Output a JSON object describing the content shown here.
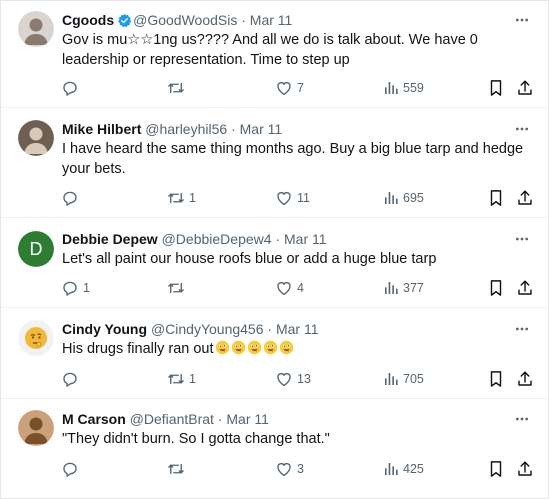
{
  "tweets": [
    {
      "name": "Cgoods",
      "handle": "@GoodWoodSis",
      "separator": "·",
      "date": "Mar 11",
      "verified": true,
      "avatar": {
        "kind": "photo",
        "bg": "#d9d4cf",
        "fg": "#8a7b6e"
      },
      "text": "Gov is mu☆☆1ng us???? And all we do is talk about. We have 0 leadership or representation. Time to step up",
      "replies": "",
      "reposts": "",
      "likes": "7",
      "views": "559"
    },
    {
      "name": "Mike Hilbert",
      "handle": "@harleyhil56",
      "separator": "·",
      "date": "Mar 11",
      "verified": false,
      "avatar": {
        "kind": "photo",
        "bg": "#6d5f52",
        "fg": "#d8c9b8"
      },
      "text": "I have heard the same thing months ago. Buy a big blue tarp and hedge your bets.",
      "replies": "",
      "reposts": "1",
      "likes": "11",
      "views": "695"
    },
    {
      "name": "Debbie Depew",
      "handle": "@DebbieDepew4",
      "separator": "·",
      "date": "Mar 11",
      "verified": false,
      "avatar": {
        "kind": "letter",
        "letter": "D",
        "bg": "#2e7d32"
      },
      "text": "Let's all paint our house roofs blue or add a huge blue tarp",
      "replies": "1",
      "reposts": "",
      "likes": "4",
      "views": "377"
    },
    {
      "name": "Cindy Young",
      "handle": "@CindyYoung456",
      "separator": "·",
      "date": "Mar 11",
      "verified": false,
      "avatar": {
        "kind": "emoji",
        "bg": "#f2f2f2"
      },
      "text": "His drugs finally ran out",
      "emoji_count": 5,
      "replies": "",
      "reposts": "1",
      "likes": "13",
      "views": "705"
    },
    {
      "name": "M Carson",
      "handle": "@DefiantBrat",
      "separator": "·",
      "date": "Mar 11",
      "verified": false,
      "avatar": {
        "kind": "photo",
        "bg": "#c9a27a",
        "fg": "#7a4f2c"
      },
      "text": "\"They didn't burn. So I gotta change that.\"",
      "replies": "",
      "reposts": "",
      "likes": "3",
      "views": "425"
    }
  ],
  "icons": {
    "more": "more-icon",
    "reply": "reply-icon",
    "repost": "repost-icon",
    "like": "like-icon",
    "views": "views-icon",
    "bookmark": "bookmark-icon",
    "share": "share-icon",
    "verified": "verified-badge-icon"
  },
  "colors": {
    "text": "#0f1419",
    "secondary": "#536471",
    "verified": "#1d9bf0",
    "divider": "#eff3f4"
  }
}
